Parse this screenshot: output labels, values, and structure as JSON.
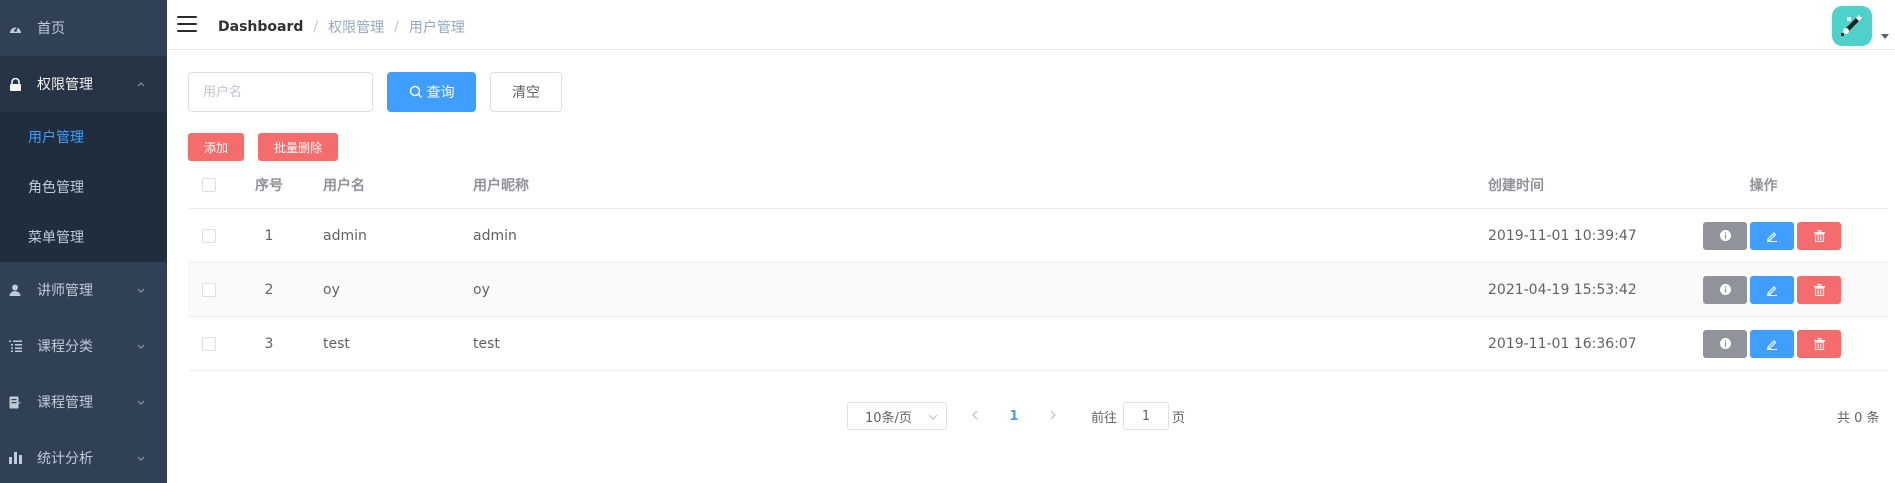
{
  "sidebar": {
    "items": [
      {
        "label": "首页",
        "icon": "dashboard-icon"
      },
      {
        "label": "权限管理",
        "icon": "lock-icon",
        "expanded": true
      },
      {
        "label": "讲师管理",
        "icon": "user-icon"
      },
      {
        "label": "课程分类",
        "icon": "list-icon"
      },
      {
        "label": "课程管理",
        "icon": "document-icon"
      },
      {
        "label": "统计分析",
        "icon": "bar-chart-icon"
      }
    ],
    "submenu": [
      {
        "label": "用户管理",
        "active": true
      },
      {
        "label": "角色管理"
      },
      {
        "label": "菜单管理"
      }
    ]
  },
  "navbar": {
    "breadcrumb": [
      "Dashboard",
      "权限管理",
      "用户管理"
    ],
    "separator": "/"
  },
  "search": {
    "placeholder": "用户名",
    "value": "",
    "query_label": "查询",
    "clear_label": "清空"
  },
  "actions": {
    "add_label": "添加",
    "batch_delete_label": "批量删除"
  },
  "table": {
    "columns": [
      "序号",
      "用户名",
      "用户昵称",
      "创建时间",
      "操作"
    ],
    "rows": [
      {
        "index": "1",
        "username": "admin",
        "nickname": "admin",
        "created": "2019-11-01 10:39:47"
      },
      {
        "index": "2",
        "username": "oy",
        "nickname": "oy",
        "created": "2021-04-19 15:53:42"
      },
      {
        "index": "3",
        "username": "test",
        "nickname": "test",
        "created": "2019-11-01 16:36:07"
      }
    ]
  },
  "pagination": {
    "page_size": "10条/页",
    "current_page": "1",
    "goto_label": "前往",
    "goto_value": "1",
    "page_suffix": "页",
    "total_text": "共 0 条"
  },
  "colors": {
    "sidebar_bg": "#304156",
    "submenu_bg": "#1f2d3d",
    "primary": "#409eff",
    "danger": "#f56c6c",
    "info": "#909399",
    "avatar_bg": "#4fd1cb"
  }
}
